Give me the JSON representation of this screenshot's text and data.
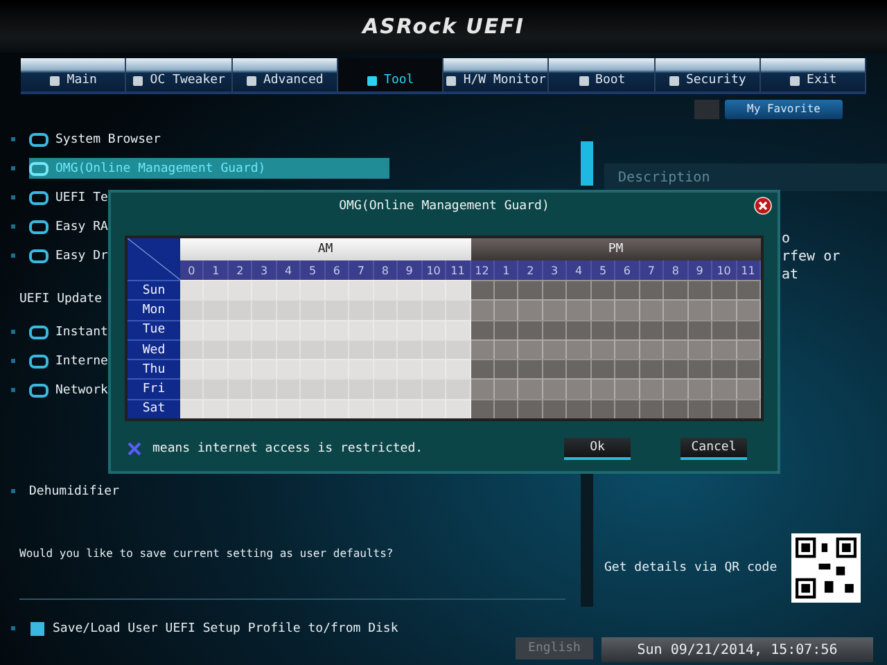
{
  "header": {
    "logo": "ASRock UEFI"
  },
  "tabs": [
    {
      "label": "Main",
      "selected": false
    },
    {
      "label": "OC Tweaker",
      "selected": false
    },
    {
      "label": "Advanced",
      "selected": false
    },
    {
      "label": "Tool",
      "selected": true
    },
    {
      "label": "H/W Monitor",
      "selected": false
    },
    {
      "label": "Boot",
      "selected": false
    },
    {
      "label": "Security",
      "selected": false
    },
    {
      "label": "Exit",
      "selected": false
    }
  ],
  "favorite_button": "My Favorite",
  "menu_items": [
    {
      "label": "System Browser",
      "selected": false
    },
    {
      "label": "OMG(Online Management Guard)",
      "selected": true
    },
    {
      "label": "UEFI Te",
      "selected": false
    },
    {
      "label": "Easy RA",
      "selected": false
    },
    {
      "label": "Easy Dr",
      "selected": false
    }
  ],
  "section_label": "UEFI Update",
  "update_items": [
    "Instant",
    "Interne",
    "Network"
  ],
  "dehumidifier": "Dehumidifier",
  "save_prompt": "Would you like to save current setting as user defaults?",
  "profile_item": "Save/Load User UEFI Setup Profile to/from Disk",
  "description": {
    "title": "Description",
    "lines": [
      "o",
      "rfew or",
      "at"
    ]
  },
  "qr_label": "Get details via QR code",
  "status_bar": {
    "language": "English",
    "datetime": "Sun 09/21/2014, 15:07:56"
  },
  "dialog": {
    "title": "OMG(Online Management Guard)",
    "am_label": "AM",
    "pm_label": "PM",
    "hours": [
      "0",
      "1",
      "2",
      "3",
      "4",
      "5",
      "6",
      "7",
      "8",
      "9",
      "10",
      "11",
      "12",
      "1",
      "2",
      "3",
      "4",
      "5",
      "6",
      "7",
      "8",
      "9",
      "10",
      "11"
    ],
    "days": [
      "Sun",
      "Mon",
      "Tue",
      "Wed",
      "Thu",
      "Fri",
      "Sat"
    ],
    "legend": "means internet access is restricted.",
    "buttons": [
      "Ok",
      "Cancel"
    ]
  }
}
